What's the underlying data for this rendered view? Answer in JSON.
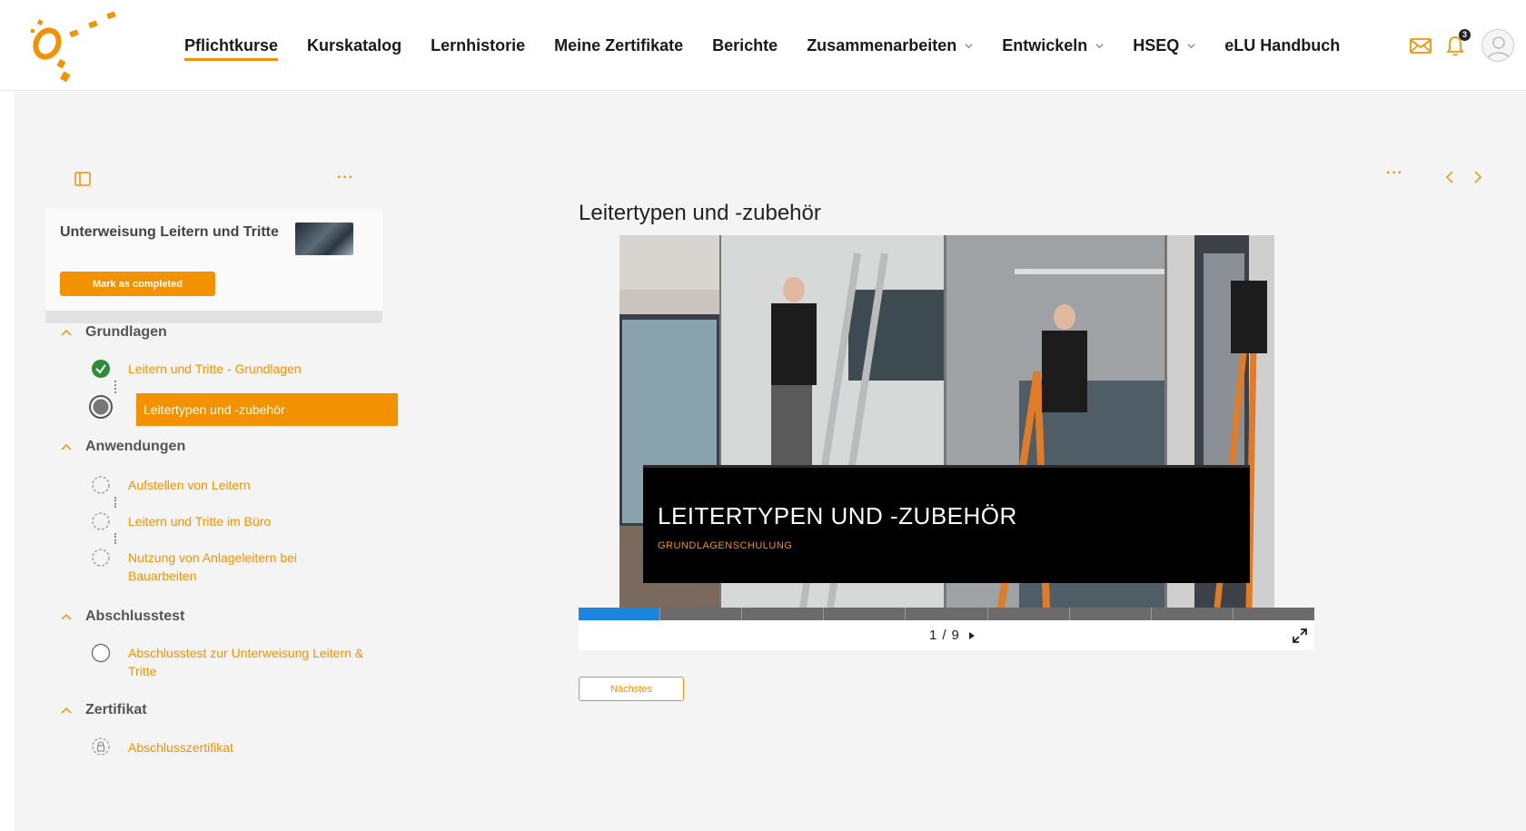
{
  "nav": {
    "items": [
      {
        "label": "Pflichtkurse",
        "active": true
      },
      {
        "label": "Kurskatalog"
      },
      {
        "label": "Lernhistorie"
      },
      {
        "label": "Meine Zertifikate"
      },
      {
        "label": "Berichte"
      },
      {
        "label": "Zusammenarbeiten",
        "dropdown": true
      },
      {
        "label": "Entwickeln",
        "dropdown": true
      },
      {
        "label": "HSEQ",
        "dropdown": true
      },
      {
        "label": "eLU Handbuch"
      }
    ],
    "notification_count": "3",
    "accent": "#f39200"
  },
  "sidebar": {
    "course_title": "Unterweisung Leitern und Tritte",
    "mark_completed_label": "Mark as completed",
    "sections": [
      {
        "title": "Grundlagen",
        "items": [
          {
            "label": "Leitern und Tritte - Grundlagen",
            "status": "completed"
          },
          {
            "label": "Leitertypen und -zubehör",
            "status": "current"
          }
        ]
      },
      {
        "title": "Anwendungen",
        "items": [
          {
            "label": "Aufstellen von Leitern",
            "status": "not-started"
          },
          {
            "label": "Leitern und Tritte im Büro",
            "status": "not-started"
          },
          {
            "label": "Nutzung von Anlageleitern bei Bauarbeiten",
            "status": "not-started"
          }
        ]
      },
      {
        "title": "Abschlusstest",
        "items": [
          {
            "label": "Abschlusstest zur Unterweisung Leitern & Tritte",
            "status": "test"
          }
        ]
      },
      {
        "title": "Zertifikat",
        "items": [
          {
            "label": "Abschlusszertifikat",
            "status": "locked"
          }
        ]
      }
    ]
  },
  "content": {
    "title": "Leitertypen und -zubehör",
    "slide": {
      "heading": "LEITERTYPEN UND -ZUBEHÖR",
      "subheading": "GRUNDLAGENSCHULUNG"
    },
    "pager": {
      "current": "1",
      "separator": "/",
      "total": "9"
    },
    "progress": {
      "total_segments": 9,
      "completed_segments": 1
    },
    "next_button_label": "Nächstes"
  }
}
